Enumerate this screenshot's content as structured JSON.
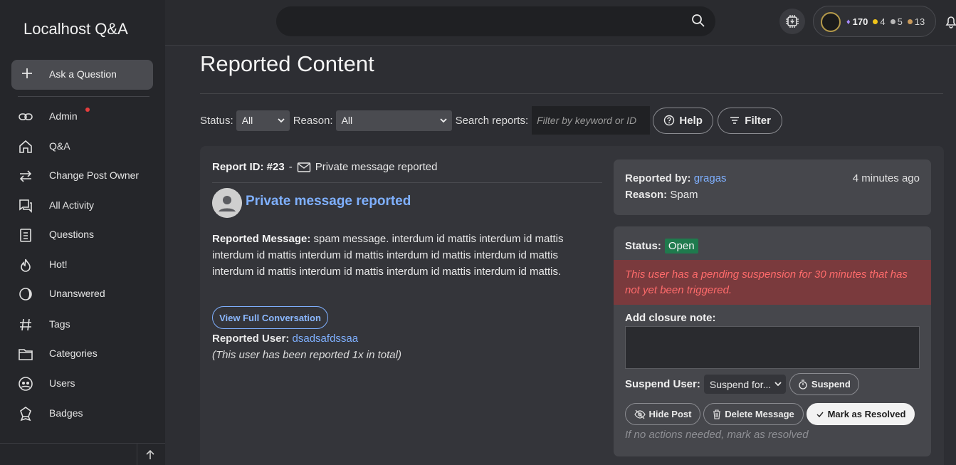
{
  "app": {
    "title": "Localhost Q&A"
  },
  "sidebar": {
    "ask_label": "Ask a Question",
    "items": [
      {
        "label": "Admin",
        "icon": "link-icon"
      },
      {
        "label": "Q&A",
        "icon": "home-icon"
      },
      {
        "label": "Change Post Owner",
        "icon": "swap-icon"
      },
      {
        "label": "All Activity",
        "icon": "activity-icon"
      },
      {
        "label": "Questions",
        "icon": "clipboard-icon"
      },
      {
        "label": "Hot!",
        "icon": "flame-icon"
      },
      {
        "label": "Unanswered",
        "icon": "half-moon-icon"
      },
      {
        "label": "Tags",
        "icon": "hash-icon"
      },
      {
        "label": "Categories",
        "icon": "folder-icon"
      },
      {
        "label": "Users",
        "icon": "users-icon"
      },
      {
        "label": "Badges",
        "icon": "badge-icon"
      }
    ]
  },
  "topbar": {
    "reputation": "170",
    "gold": "4",
    "silver": "5",
    "bronze": "13",
    "colors": {
      "gem": "#a88cff",
      "gold": "#f0c419",
      "silver": "#b8b8b8",
      "bronze": "#c99a5b"
    }
  },
  "main": {
    "title": "Reported Content",
    "filters": {
      "status_label": "Status:",
      "status_value": "All",
      "reason_label": "Reason:",
      "reason_value": "All",
      "search_label": "Search reports:",
      "search_placeholder": "Filter by keyword or ID",
      "help_label": "Help",
      "filter_label": "Filter"
    },
    "report": {
      "id_label": "Report ID: #23",
      "separator": "-",
      "type_label": "Private message reported",
      "post_title": "Private message reported",
      "message_label": "Reported Message:",
      "message_text": "spam message. interdum id mattis interdum id mattis interdum id mattis interdum id mattis interdum id mattis interdum id mattis interdum id mattis interdum id mattis interdum id mattis interdum id mattis.",
      "view_label": "View Full Conversation",
      "user_label": "Reported User:",
      "user_value": "dsadsafdssaa",
      "count_text": "(This user has been reported 1x in total)"
    },
    "details": {
      "by_label": "Reported by:",
      "by_value": "gragas",
      "time": "4 minutes ago",
      "reason_label": "Reason:",
      "reason_value": "Spam"
    },
    "actions": {
      "status_label": "Status:",
      "status_value": "Open",
      "warning": "This user has a pending suspension for 30 minutes that has not yet been triggered.",
      "note_label": "Add closure note:",
      "suspend_label": "Suspend User:",
      "suspend_select": "Suspend for...",
      "suspend_button": "Suspend",
      "hide_label": "Hide Post",
      "delete_label": "Delete Message",
      "resolve_label": "Mark as Resolved",
      "hint": "If no actions needed, mark as resolved"
    }
  }
}
